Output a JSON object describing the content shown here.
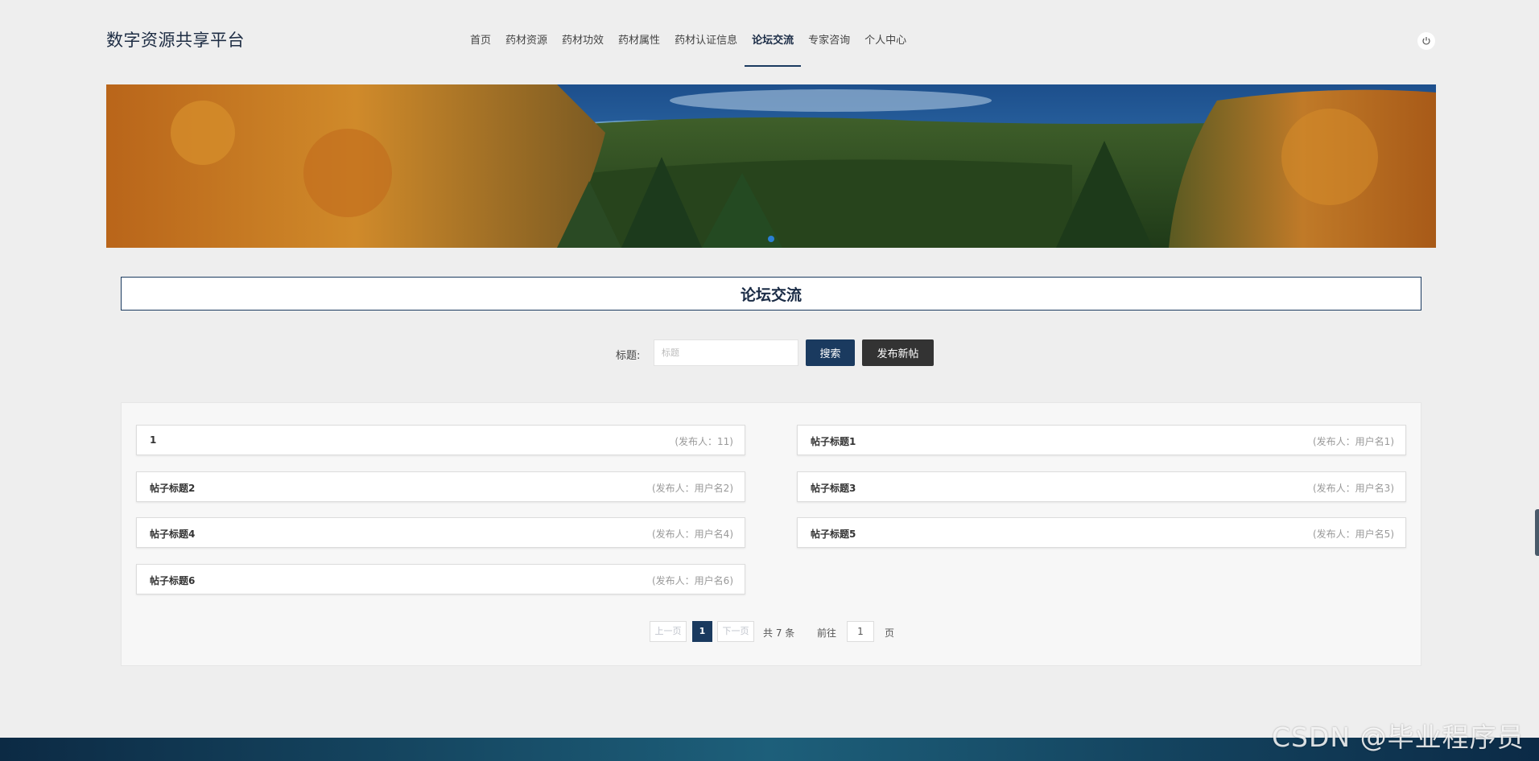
{
  "header": {
    "site_title": "数字资源共享平台",
    "nav": [
      {
        "label": "首页",
        "active": false
      },
      {
        "label": "药材资源",
        "active": false
      },
      {
        "label": "药材功效",
        "active": false
      },
      {
        "label": "药材属性",
        "active": false
      },
      {
        "label": "药材认证信息",
        "active": false
      },
      {
        "label": "论坛交流",
        "active": true
      },
      {
        "label": "专家咨询",
        "active": false
      },
      {
        "label": "个人中心",
        "active": false
      }
    ],
    "power_icon": "power-icon"
  },
  "banner": {
    "image_icon": "forest-landscape",
    "active_dot_color": "#2b7fd4"
  },
  "section": {
    "title": "论坛交流"
  },
  "search": {
    "label": "标题:",
    "placeholder": "标题",
    "value": "",
    "search_button": "搜索",
    "post_button": "发布新帖"
  },
  "posts": [
    {
      "title": "1",
      "author": "(发布人：11)"
    },
    {
      "title": "帖子标题1",
      "author": "(发布人：用户名1)"
    },
    {
      "title": "帖子标题2",
      "author": "(发布人：用户名2)"
    },
    {
      "title": "帖子标题3",
      "author": "(发布人：用户名3)"
    },
    {
      "title": "帖子标题4",
      "author": "(发布人：用户名4)"
    },
    {
      "title": "帖子标题5",
      "author": "(发布人：用户名5)"
    },
    {
      "title": "帖子标题6",
      "author": "(发布人：用户名6)"
    }
  ],
  "pagination": {
    "prev": "上一页",
    "current": "1",
    "next": "下一页",
    "total": "共 7 条",
    "goto_label": "前往",
    "goto_value": "1",
    "page_suffix": "页"
  },
  "watermark": "CSDN @毕业程序员",
  "colors": {
    "primary": "#1a3a5f",
    "dark_button": "#333333",
    "page_bg": "#eeeeee"
  }
}
